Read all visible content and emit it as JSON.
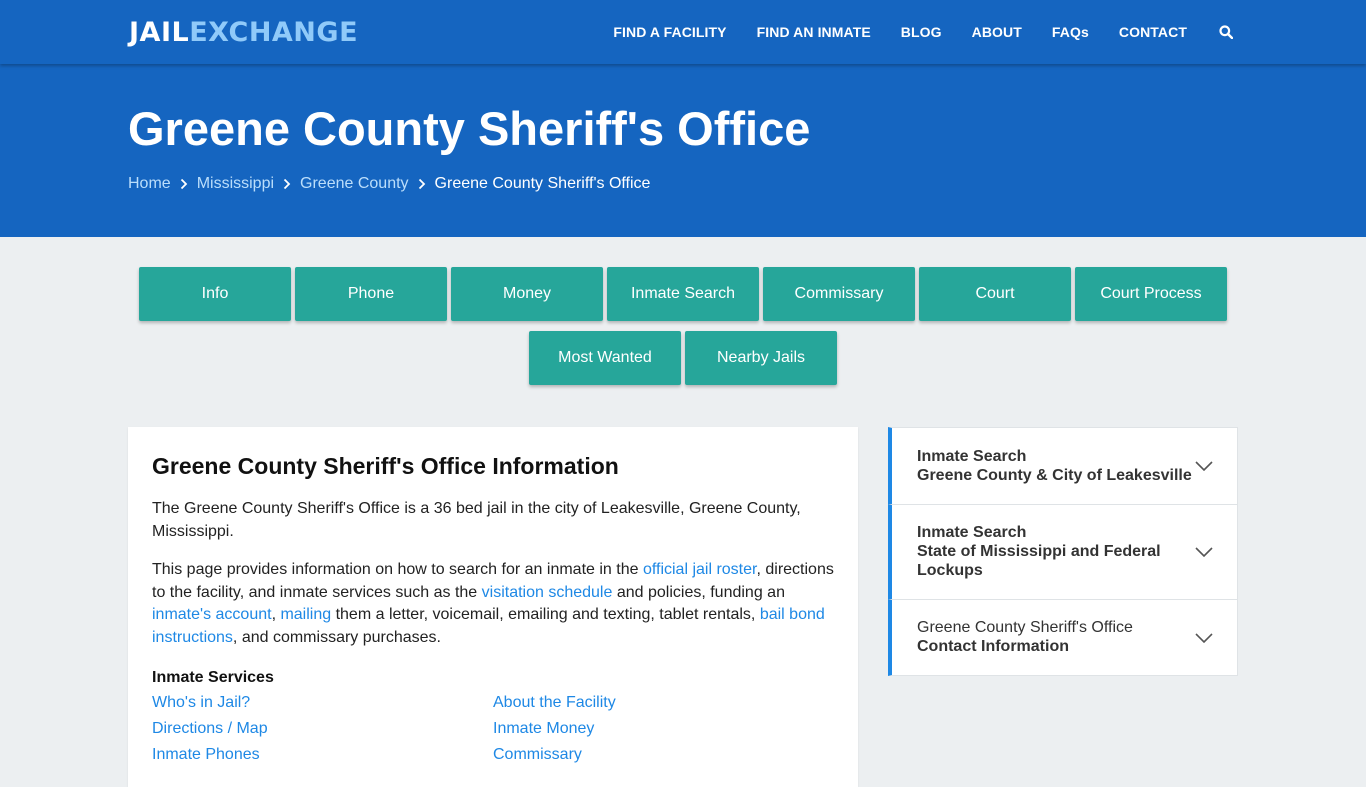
{
  "logo": {
    "part1": "JAIL",
    "part2": "EXCHANGE"
  },
  "nav": {
    "items": [
      "FIND A FACILITY",
      "FIND AN INMATE",
      "BLOG",
      "ABOUT",
      "FAQs",
      "CONTACT"
    ],
    "search_icon": "search-icon"
  },
  "hero": {
    "title": "Greene County Sheriff's Office",
    "breadcrumb": [
      "Home",
      "Mississippi",
      "Greene County",
      "Greene County Sheriff's Office"
    ]
  },
  "tabs": {
    "row1": [
      "Info",
      "Phone",
      "Money",
      "Inmate Search",
      "Commissary",
      "Court",
      "Court Process"
    ],
    "row2": [
      "Most Wanted",
      "Nearby Jails"
    ]
  },
  "main": {
    "heading": "Greene County Sheriff's Office Information",
    "p1": "The Greene County Sheriff's Office is a 36 bed jail in the city of Leakesville, Greene County, Mississippi.",
    "p2": {
      "t1": "This page provides information on how to search for an inmate in the ",
      "l1": "official jail roster",
      "t2": ", directions to the facility, and inmate services such as the ",
      "l2": "visitation schedule",
      "t3": " and policies, funding an ",
      "l3": "inmate's account",
      "t4": ", ",
      "l4": "mailing",
      "t5": " them a letter, voicemail, emailing and texting, tablet rentals, ",
      "l5": "bail bond instructions",
      "t6": ", and commissary purchases."
    },
    "services_heading": "Inmate Services",
    "services_left": [
      "Who's in Jail?",
      "Directions / Map",
      "Inmate Phones"
    ],
    "services_right": [
      "About the Facility",
      "Inmate Money",
      "Commissary"
    ]
  },
  "sidebar": {
    "panels": [
      {
        "line1": "Inmate Search",
        "line2": "Greene County & City of Leakesville"
      },
      {
        "line1": "Inmate Search",
        "line2": "State of Mississippi and Federal",
        "line3": "Lockups"
      },
      {
        "line1": "Greene County Sheriff's Office",
        "line2": "Contact Information"
      }
    ]
  },
  "colors": {
    "brand": "#1565c0",
    "tab": "#26a69a",
    "link": "#1e88e5"
  }
}
